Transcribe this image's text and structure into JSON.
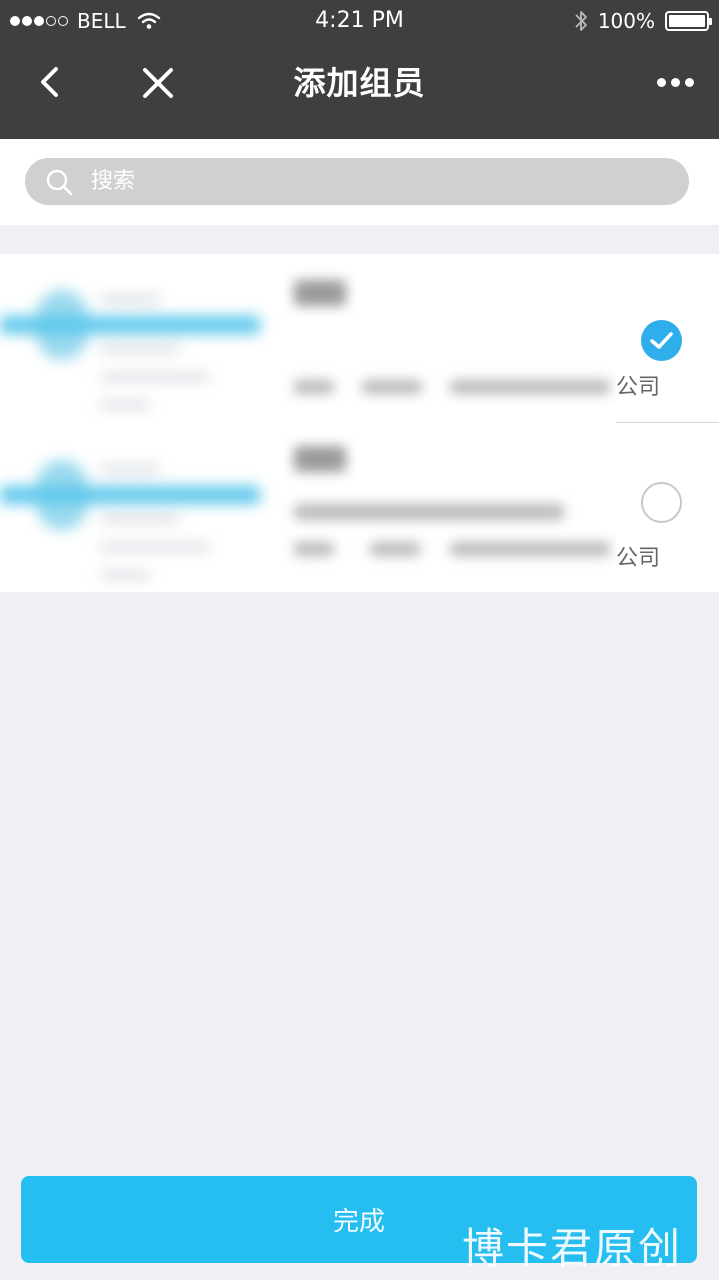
{
  "status_bar": {
    "carrier": "BELL",
    "time": "4:21 PM",
    "battery": "100%",
    "signal_bars_filled": 3,
    "signal_bars_total": 5
  },
  "nav": {
    "title": "添加组员",
    "back_icon": "chevron-left-icon",
    "close_icon": "close-icon",
    "more_icon": "more-dots-icon"
  },
  "search": {
    "placeholder": "搜索",
    "value": "",
    "icon": "search-icon"
  },
  "members": [
    {
      "company": "公司",
      "selected": true
    },
    {
      "company": "公司",
      "selected": false
    }
  ],
  "done_button": {
    "label": "完成"
  },
  "watermark": {
    "text": "博卡君原创"
  },
  "colors": {
    "header_bg": "#3f3f3f",
    "accent": "#2eaeea",
    "button_bg": "#26bdf1",
    "page_bg": "#efeff4"
  }
}
